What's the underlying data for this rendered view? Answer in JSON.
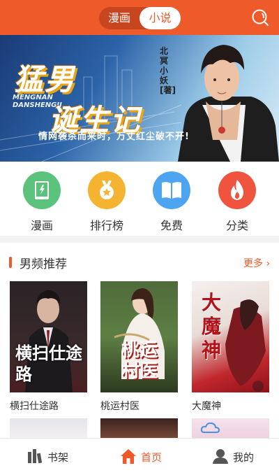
{
  "header": {
    "segments": [
      "漫画",
      "小说"
    ],
    "active_segment": "小说",
    "search_icon": "search-icon"
  },
  "banner": {
    "title_line1": "猛男",
    "title_line2": "诞生记",
    "pinyin_line1": "MENGNAN",
    "pinyin_line2": "DANSHENGJI",
    "tagline": "情网袭杀而来时，万丈红尘破不开!",
    "author": "北冥小妖[著]"
  },
  "categories": [
    {
      "label": "漫画",
      "icon": "book-icon",
      "color": "#5ac27a"
    },
    {
      "label": "排行榜",
      "icon": "medal-icon",
      "color": "#f5b332"
    },
    {
      "label": "免费",
      "icon": "open-book-icon",
      "color": "#4da4f0"
    },
    {
      "label": "分类",
      "icon": "flame-icon",
      "color": "#f0533e"
    }
  ],
  "section": {
    "title": "男频推荐",
    "more": "更多"
  },
  "books": [
    {
      "name": "横扫仕途路",
      "cover_title": "横扫仕途路"
    },
    {
      "name": "桃运村医",
      "cover_title": "桃运村医"
    },
    {
      "name": "大魔神",
      "cover_title": "大魔神"
    }
  ],
  "tabbar": {
    "items": [
      {
        "label": "书架",
        "icon": "bookshelf-icon"
      },
      {
        "label": "首页",
        "icon": "home-icon"
      },
      {
        "label": "我的",
        "icon": "user-icon"
      }
    ],
    "active": "首页"
  },
  "colors": {
    "accent": "#ef5a2a",
    "tab_inactive": "#333333"
  }
}
